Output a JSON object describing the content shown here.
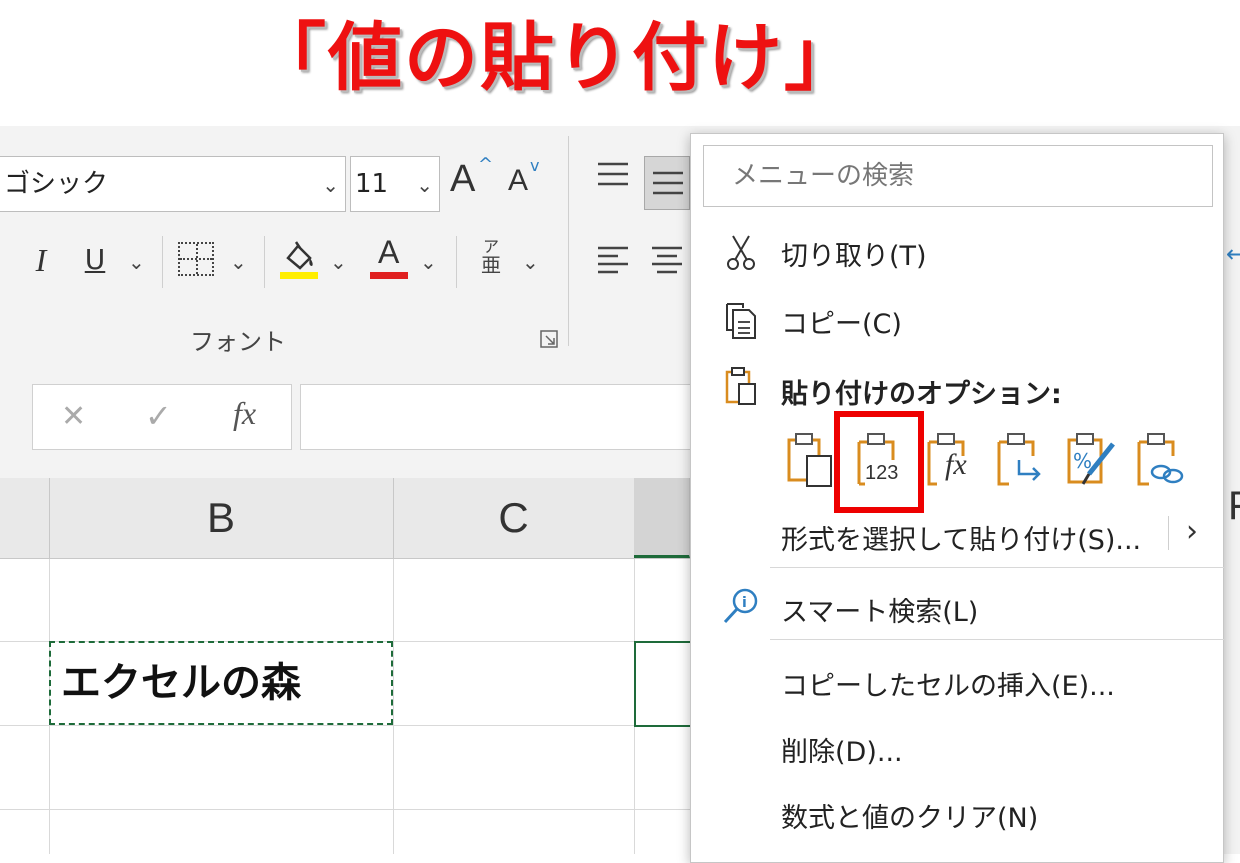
{
  "title": "「値の貼り付け」",
  "ribbon": {
    "font_name": "ゴシック",
    "font_size": "11",
    "grow_font": "A",
    "shrink_font": "A",
    "italic": "I",
    "underline": "U",
    "font_color_letter": "A",
    "phonetic_top": "ア",
    "phonetic_bottom": "亜",
    "group_label": "フォント"
  },
  "formula_bar": {
    "cancel": "✕",
    "enter": "✓",
    "fx": "fx"
  },
  "grid": {
    "columns": [
      "B",
      "C"
    ],
    "cell_b_value": "エクセルの森",
    "partial_col": "F"
  },
  "context_menu": {
    "search_placeholder": "メニューの検索",
    "cut": "切り取り(T)",
    "copy": "コピー(C)",
    "paste_options_label": "貼り付けのオプション:",
    "paste_values_digits": "123",
    "paste_formula_fx": "fx",
    "paste_special": "形式を選択して貼り付け(S)...",
    "smart_lookup": "スマート検索(L)",
    "insert_copied": "コピーしたセルの挿入(E)...",
    "delete": "削除(D)...",
    "clear_contents": "数式と値のクリア(N)"
  },
  "colors": {
    "title_red": "#ee1111",
    "highlight_red": "#ee0000",
    "clipboard_orange": "#d98c1f",
    "accent_blue": "#2f7fc1",
    "cell_green": "#1e6b3a",
    "highlight_yellow": "#ffee00",
    "font_red": "#e02020"
  }
}
